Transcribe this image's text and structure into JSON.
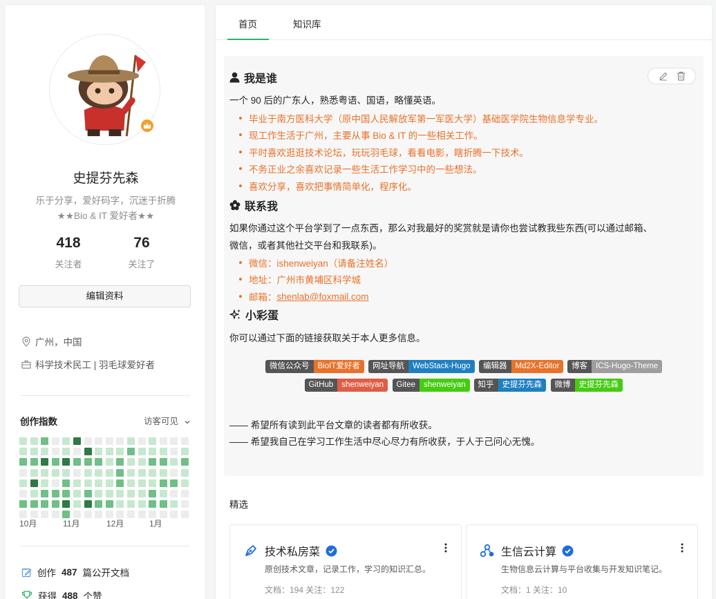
{
  "profile": {
    "name": "史提芬先森",
    "bio_line1": "乐于分享，爱好码字，沉迷于折腾",
    "bio_line2": "★★Bio & IT 爱好者★★",
    "followers_count": "418",
    "followers_label": "关注者",
    "following_count": "76",
    "following_label": "关注了",
    "edit_button": "编辑资料",
    "location": "广州，中国",
    "occupation": "科学技术民工 | 羽毛球爱好者",
    "activity_title": "创作指数",
    "visibility": "访客可见",
    "months": [
      "10月",
      "11月",
      "12月",
      "1月"
    ],
    "docs_prefix": "创作",
    "docs_count": "487",
    "docs_suffix": "篇公开文档",
    "likes_prefix": "获得",
    "likes_count": "488",
    "likes_suffix": "个赞"
  },
  "tabs": [
    "首页",
    "知识库"
  ],
  "about": {
    "who_title": "我是谁",
    "who_intro": "一个 90 后的广东人，熟悉粤语、国语，略懂英语。",
    "who_items": [
      "毕业于南方医科大学（原中国人民解放军第一军医大学）基础医学院生物信息学专业。",
      "现工作生活于广州，主要从事 Bio & IT 的一些相关工作。",
      "平时喜欢逛逛技术论坛，玩玩羽毛球，看看电影，瞎折腾一下技术。",
      "不务正业之余喜欢记录一些生活工作学习中的一些想法。",
      "喜欢分享，喜欢把事情简单化，程序化。"
    ],
    "contact_title": "联系我",
    "contact_line1": "如果你通过这个平台学到了一点东西，那么对我最好的奖赏就是请你也尝试教我些东西(可以通过邮箱、",
    "contact_line2": "微信，或者其他社交平台和我联系)。",
    "contact_wechat": "微信：ishenweiyan（请备注姓名）",
    "contact_address": "地址：广州市黄埔区科学城",
    "contact_email_label": "邮箱：",
    "contact_email": "shenlab@foxmail.com",
    "egg_title": "小彩蛋",
    "egg_text": "你可以通过下面的链接获取关于本人更多信息。",
    "badges_row1": [
      {
        "key": "微信公众号",
        "value": "BioIT爱好者",
        "color": "#e8722a"
      },
      {
        "key": "网址导航",
        "value": "WebStack-Hugo",
        "color": "#1e7fc1"
      },
      {
        "key": "编辑器",
        "value": "Md2X-Editor",
        "color": "#e8722a"
      },
      {
        "key": "博客",
        "value": "ICS-Hugo-Theme",
        "color": "#9e9e9e"
      }
    ],
    "badges_row2": [
      {
        "key": "GitHub",
        "value": "shenweiyan",
        "color": "#e05d44"
      },
      {
        "key": "Gitee",
        "value": "shenweiyan",
        "color": "#4c1"
      },
      {
        "key": "知乎",
        "value": "史提芬先森",
        "color": "#1e7fc1"
      },
      {
        "key": "微博",
        "value": "史提芬先森",
        "color": "#4c1"
      }
    ],
    "closing1": "—— 希望所有读到此平台文章的读者都有所收获。",
    "closing2": "—— 希望我自己在学习工作生活中尽心尽力有所收获，于人于己问心无愧。"
  },
  "featured": {
    "label": "精选",
    "cards": [
      {
        "title": "技术私房菜",
        "desc": "原创技术文章，记录工作，学习的知识汇总。",
        "meta": "文档：194    关注：122"
      },
      {
        "title": "生信云计算",
        "desc": "生物信息云计算与平台收集与开发知识笔记。",
        "meta": "文档：1    关注：10"
      }
    ]
  },
  "colors": {
    "accent_green": "#25b864",
    "bullet_orange": "#e8722a"
  },
  "heatmap_levels": [
    [
      1,
      1,
      2,
      0,
      1,
      3,
      0,
      0,
      0,
      0,
      1,
      0,
      1,
      0,
      0,
      0
    ],
    [
      1,
      1,
      1,
      0,
      1,
      0,
      3,
      1,
      1,
      1,
      2,
      1,
      1,
      1,
      0,
      1
    ],
    [
      2,
      2,
      3,
      2,
      3,
      2,
      2,
      2,
      1,
      2,
      1,
      1,
      2,
      2,
      1,
      2
    ],
    [
      0,
      1,
      1,
      1,
      1,
      0,
      1,
      1,
      1,
      2,
      1,
      1,
      1,
      1,
      0,
      1
    ],
    [
      1,
      3,
      1,
      0,
      2,
      1,
      1,
      1,
      1,
      2,
      1,
      1,
      1,
      2,
      2,
      1
    ],
    [
      0,
      1,
      2,
      2,
      2,
      1,
      2,
      1,
      1,
      1,
      1,
      1,
      2,
      1,
      0,
      0
    ],
    [
      2,
      2,
      2,
      2,
      3,
      1,
      3,
      2,
      2,
      1,
      1,
      1,
      2,
      2,
      1,
      0
    ],
    [
      0,
      0,
      0,
      0,
      2,
      0,
      0,
      0,
      0,
      0,
      0,
      0,
      0,
      0,
      0,
      0
    ]
  ]
}
